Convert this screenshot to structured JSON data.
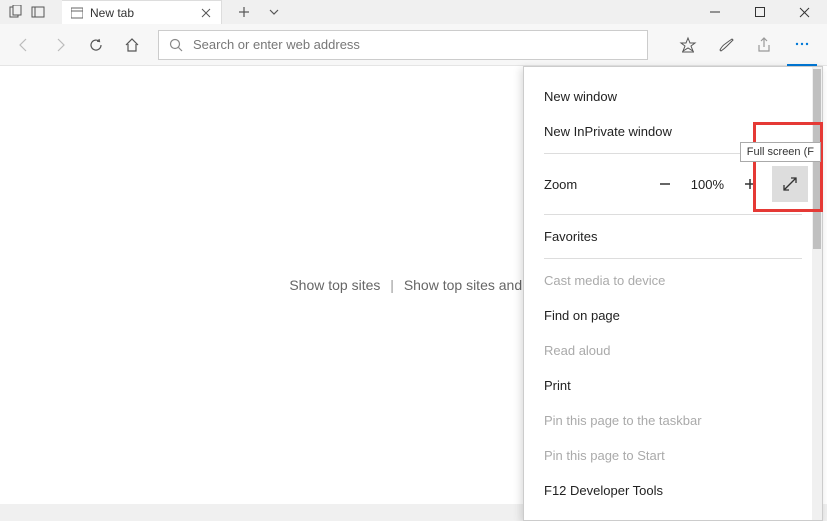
{
  "tab": {
    "title": "New tab"
  },
  "address": {
    "placeholder": "Search or enter web address"
  },
  "page": {
    "top_sites": "Show top sites",
    "top_sites_more": "Show top sites and m"
  },
  "menu": {
    "new_window": "New window",
    "new_inprivate": "New InPrivate window",
    "zoom_label": "Zoom",
    "zoom_value": "100%",
    "favorites": "Favorites",
    "cast": "Cast media to device",
    "find": "Find on page",
    "read_aloud": "Read aloud",
    "print": "Print",
    "pin_taskbar": "Pin this page to the taskbar",
    "pin_start": "Pin this page to Start",
    "dev_tools": "F12 Developer Tools"
  },
  "tooltip": {
    "fullscreen": "Full screen (F"
  }
}
